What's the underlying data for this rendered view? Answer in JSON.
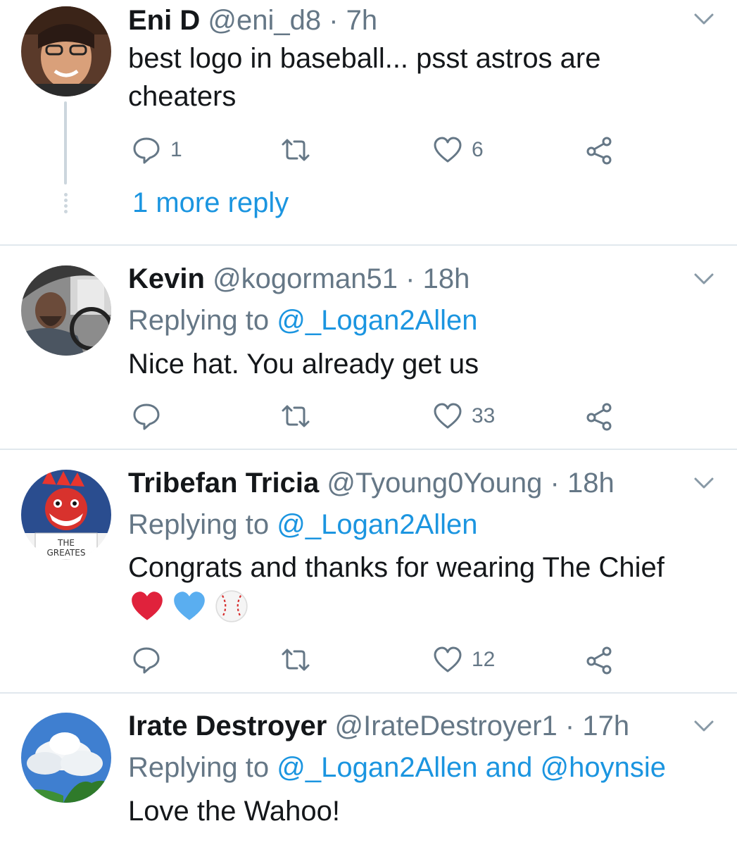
{
  "tweets": [
    {
      "name": "Eni D",
      "handle": "@eni_d8",
      "sep": "·",
      "time": "7h",
      "text_lines": [
        "best logo in baseball... psst astros are",
        "cheaters"
      ],
      "replies": "1",
      "retweets": "",
      "likes": "6",
      "more_replies": "1 more reply"
    },
    {
      "name": "Kevin",
      "handle": "@kogorman51",
      "sep": "·",
      "time": "18h",
      "replying_prefix": "Replying to",
      "replying_to": "@_Logan2Allen",
      "text": "Nice hat. You already get us",
      "replies": "",
      "retweets": "",
      "likes": "33"
    },
    {
      "name": "Tribefan Tricia",
      "handle": "@Tyoung0Young",
      "sep": "·",
      "time": "18h",
      "replying_prefix": "Replying to",
      "replying_to": "@_Logan2Allen",
      "text": "Congrats and thanks for wearing The Chief",
      "emoji": [
        "red-heart",
        "blue-heart",
        "baseball"
      ],
      "avatar_text_1": "THE",
      "avatar_text_2": "GREATES",
      "replies": "",
      "retweets": "",
      "likes": "12"
    },
    {
      "name": "Irate Destroyer",
      "handle": "@IrateDestroyer1",
      "sep": "·",
      "time": "17h",
      "replying_prefix": "Replying to",
      "replying_to": "@_Logan2Allen and @hoynsie",
      "text": "Love the Wahoo!"
    }
  ],
  "colors": {
    "link": "#1b95e0",
    "meta": "#657786",
    "divider": "#e1e8ed",
    "text": "#14171a"
  },
  "icons": {
    "reply": "reply-icon",
    "retweet": "retweet-icon",
    "like": "heart-icon",
    "share": "share-icon",
    "menu": "chevron-down-icon"
  }
}
